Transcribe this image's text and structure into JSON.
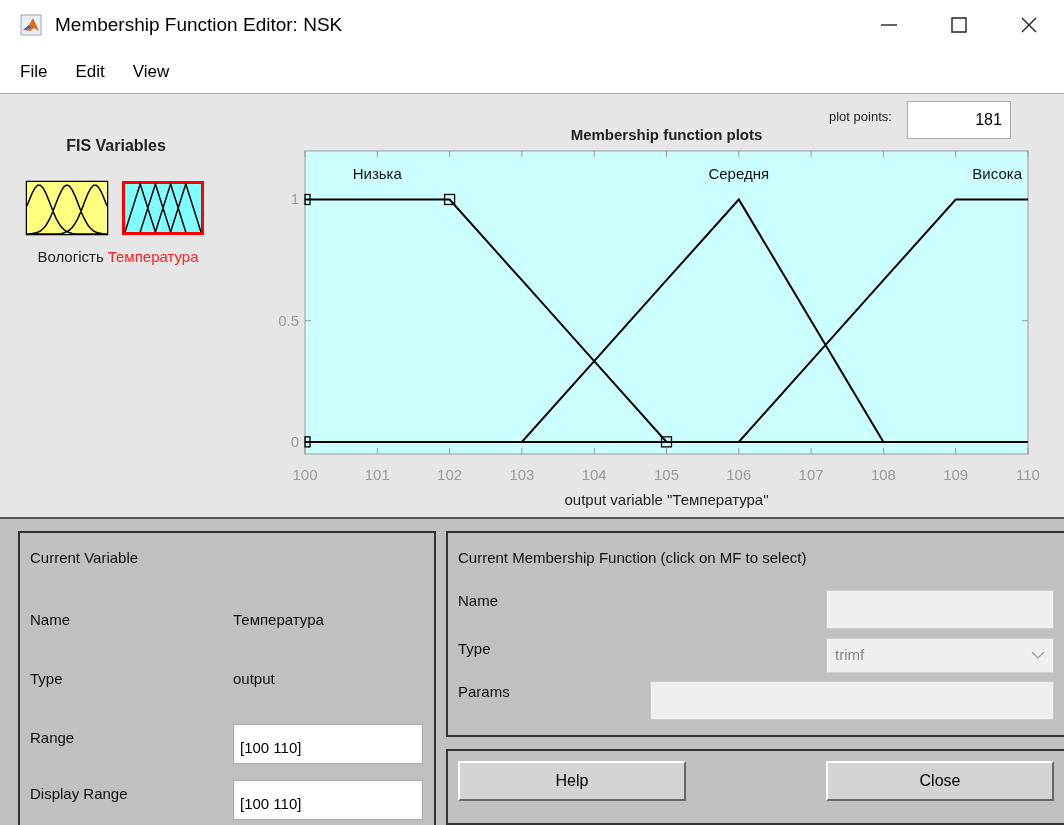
{
  "window": {
    "title": "Membership Function Editor: NSK"
  },
  "menu": [
    "File",
    "Edit",
    "View"
  ],
  "fis_variables": {
    "title": "FIS Variables",
    "items": [
      {
        "name": "Вологість",
        "kind": "input",
        "selected": false
      },
      {
        "name": "Температура",
        "kind": "output",
        "selected": true
      }
    ]
  },
  "plot": {
    "plot_points_label": "plot points:",
    "plot_points": "181",
    "chart_data": {
      "type": "line",
      "title": "Membership function plots",
      "xlabel": "output variable \"Температура\"",
      "x": [
        100,
        101,
        102,
        103,
        104,
        105,
        106,
        107,
        108,
        109,
        110
      ],
      "series": [
        {
          "name": "Низька",
          "color": "#000000",
          "values": [
            1,
            1,
            1,
            0.667,
            0.333,
            0,
            0,
            0,
            0,
            0,
            0
          ]
        },
        {
          "name": "Середня",
          "color": "#000000",
          "values": [
            0,
            0,
            0,
            0,
            0.333,
            0.667,
            1,
            0.5,
            0,
            0,
            0
          ]
        },
        {
          "name": "Висока",
          "color": "#000000",
          "values": [
            0,
            0,
            0,
            0,
            0,
            0,
            0,
            0.333,
            0.667,
            1,
            1
          ]
        }
      ],
      "xlim": [
        100,
        110
      ],
      "ylim": [
        -0.05,
        1.2
      ],
      "xticks": [
        100,
        101,
        102,
        103,
        104,
        105,
        106,
        107,
        108,
        109,
        110
      ],
      "yticks": [
        0,
        0.5,
        1
      ]
    },
    "mf_items": [
      {
        "selected": true
      },
      {
        "selected": false
      },
      {
        "selected": false
      }
    ]
  },
  "current_variable": {
    "title": "Current Variable",
    "name_label": "Name",
    "name": "Температура",
    "type_label": "Type",
    "type": "output",
    "range_label": "Range",
    "range": "[100 110]",
    "display_range_label": "Display Range",
    "display_range": "[100 110]"
  },
  "current_mf": {
    "title": "Current Membership Function (click on MF to select)",
    "name_label": "Name",
    "type_label": "Type",
    "type": "trimf",
    "params_label": "Params",
    "disabled": true
  },
  "buttons": [
    "Help",
    "Close"
  ]
}
